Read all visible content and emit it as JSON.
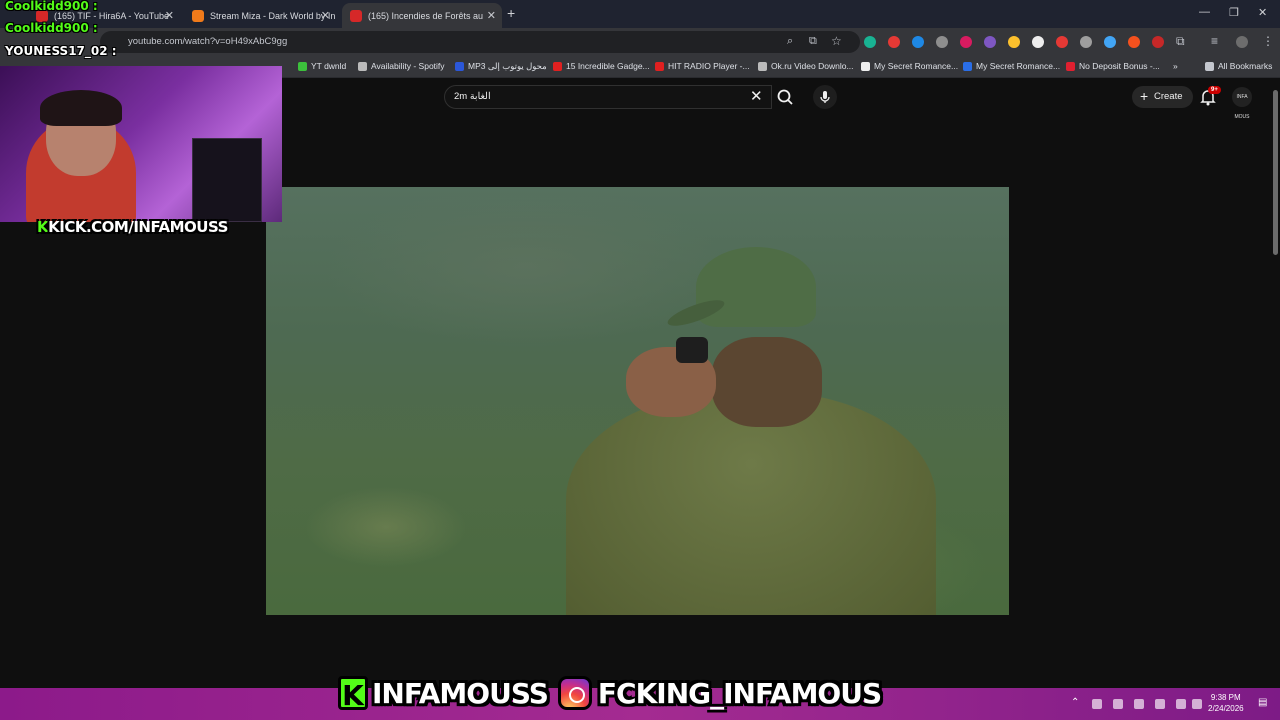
{
  "browser": {
    "tabs": [
      {
        "title": "(165) TIF - Hira6A - YouTube",
        "color": "#d62828"
      },
      {
        "title": "Stream Miza - Dark World by In",
        "color": "#f07a1a"
      },
      {
        "title": "(165) Incendies de Forêts au",
        "color": "#d62828"
      }
    ],
    "new_tab": "+",
    "url": "youtube.com/watch?v=oH49xAbC9gg",
    "bookmarks": [
      {
        "label": "YT dwnld",
        "color": "#3cc13c"
      },
      {
        "label": "Availability - Spotify",
        "color": "#bbbbbb"
      },
      {
        "label": "MP3 محول يوتوب إلى",
        "color": "#2b57d9"
      },
      {
        "label": "15 Incredible Gadge...",
        "color": "#e02020"
      },
      {
        "label": "HIT RADIO Player -...",
        "color": "#e02020"
      },
      {
        "label": "Ok.ru Video Downlo...",
        "color": "#bbbbbb"
      },
      {
        "label": "My Secret Romance...",
        "color": "#eeeeee"
      },
      {
        "label": "My Secret Romance...",
        "color": "#2a6ee8"
      },
      {
        "label": "No Deposit Bonus -...",
        "color": "#e02030"
      }
    ],
    "all_bookmarks": "All Bookmarks",
    "overflow": "»"
  },
  "youtube": {
    "search_value": "2m الغابة",
    "create_label": "Create",
    "notif_count": "9+",
    "avatar_text": "INFA MOUS"
  },
  "stream_overlay": {
    "chat": [
      {
        "user": "Coolkidd900 :"
      },
      {
        "user": "Coolkidd900 :"
      },
      {
        "user": "YOUNESS17_02 :"
      }
    ],
    "kick_url": "KICK.COM/INFAMOUSS",
    "banner_kick": "INFAMOUSS",
    "banner_ig": "FCKING_INFAMOUS",
    "k_glyph": "K"
  },
  "taskbar": {
    "time": "9:38 PM",
    "date": "2/24/2026"
  },
  "colors": {
    "kick_green": "#53fc18",
    "taskbar_purple": "#a42b91"
  }
}
